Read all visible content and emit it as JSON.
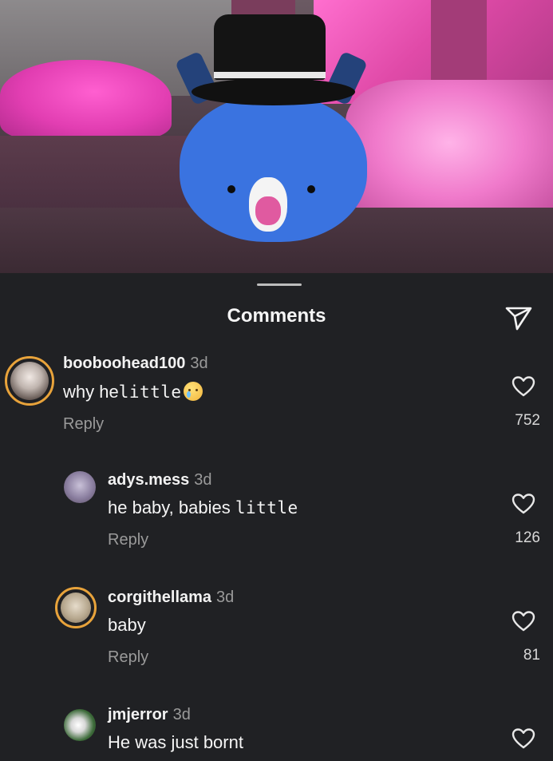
{
  "panel": {
    "title": "Comments",
    "send_icon": "send-icon"
  },
  "comments": [
    {
      "username": "booboohead100",
      "time": "3d",
      "text_prefix": "why he",
      "text_styled": "little",
      "emoji": "crying-face",
      "reply_label": "Reply",
      "likes": "752",
      "avatar_ring": true
    },
    {
      "username": "adys.mess",
      "time": "3d",
      "text_prefix": "he baby, babies ",
      "text_styled": "little",
      "reply_label": "Reply",
      "likes": "126",
      "avatar_ring": false
    },
    {
      "username": "corgithellama",
      "time": "3d",
      "text_prefix": "baby",
      "reply_label": "Reply",
      "likes": "81",
      "avatar_ring": true
    },
    {
      "username": "jmjerror",
      "time": "3d",
      "text_prefix": "He was just bornt",
      "avatar_ring": false
    }
  ],
  "colors": {
    "background": "#202124",
    "secondary_text": "#9a9a9a",
    "story_ring": "#e8a33b"
  }
}
